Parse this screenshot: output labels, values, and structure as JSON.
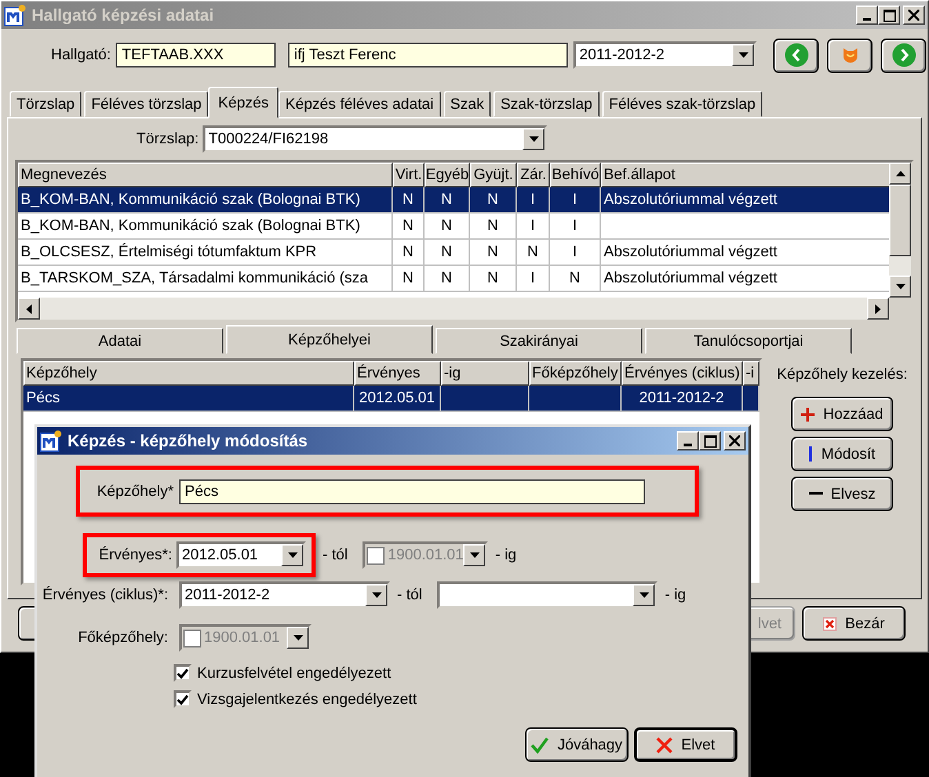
{
  "window": {
    "title": "Hallgató képzési adatai"
  },
  "student": {
    "label": "Hallgató:",
    "code": "TEFTAAB.XXX",
    "name": "ifj Teszt Ferenc",
    "term": "2011-2012-2"
  },
  "tabs": [
    {
      "label": "Törzslap",
      "selected": false
    },
    {
      "label": "Féléves törzslap",
      "selected": false
    },
    {
      "label": "Képzés",
      "selected": true
    },
    {
      "label": "Képzés féléves adatai",
      "selected": false
    },
    {
      "label": "Szak",
      "selected": false
    },
    {
      "label": "Szak-törzslap",
      "selected": false
    },
    {
      "label": "Féléves szak-törzslap",
      "selected": false
    }
  ],
  "record": {
    "label": "Törzslap:",
    "value": "T000224/FI62198"
  },
  "table": {
    "columns": [
      "Megnevezés",
      "Virt.",
      "Egyéb",
      "Gyüjt.",
      "Zár.",
      "Behívó",
      "Bef.állapot"
    ],
    "rows": [
      {
        "cells": [
          "B_KOM-BAN, Kommunikáció szak (Bolognai BTK)",
          "N",
          "N",
          "N",
          "I",
          "I",
          "Abszolutóriummal végzett"
        ],
        "selected": true
      },
      {
        "cells": [
          "B_KOM-BAN, Kommunikáció szak (Bolognai BTK)",
          "N",
          "N",
          "N",
          "I",
          "I",
          ""
        ],
        "selected": false
      },
      {
        "cells": [
          "B_OLCSESZ, Értelmiségi tótumfaktum KPR",
          "N",
          "N",
          "N",
          "N",
          "I",
          "Abszolutóriummal végzett"
        ],
        "selected": false
      },
      {
        "cells": [
          "B_TARSKOM_SZA, Társadalmi kommunikáció (sza",
          "N",
          "N",
          "N",
          "I",
          "N",
          "Abszolutóriummal végzett"
        ],
        "selected": false
      }
    ]
  },
  "subtabs": [
    {
      "label": "Adatai",
      "selected": false
    },
    {
      "label": "Képzőhelyei",
      "selected": true
    },
    {
      "label": "Szakirányai",
      "selected": false
    },
    {
      "label": "Tanulócsoportjai",
      "selected": false
    }
  ],
  "sites_table": {
    "columns": [
      "Képzőhely",
      "Érvényes",
      "-ig",
      "Főképzőhely",
      "Érvényes (ciklus)",
      "-i"
    ],
    "rows": [
      {
        "cells": [
          "Pécs",
          "2012.05.01",
          "",
          "",
          "2011-2012-2",
          ""
        ],
        "selected": true
      }
    ]
  },
  "site_actions": {
    "title": "Képzőhely kezelés:",
    "buttons": [
      {
        "label": "Hozzáad",
        "kind": "add"
      },
      {
        "label": "Módosít",
        "kind": "edit"
      },
      {
        "label": "Elvesz",
        "kind": "remove"
      }
    ]
  },
  "footer_buttons": [
    {
      "label": "lvet",
      "kind": "cancel",
      "disabled": true
    },
    {
      "label": "Bezár",
      "kind": "close",
      "disabled": false
    }
  ],
  "dialog": {
    "title": "Képzés - képzőhely módosítás",
    "site": {
      "label": "Képzőhely*",
      "value": "Pécs",
      "highlighted": true
    },
    "valid": {
      "label": "Érvényes*:",
      "value": "2012.05.01",
      "highlighted": true,
      "from": "- tól",
      "until_value": "1900.01.01",
      "until_checked": false,
      "until_disabled": true,
      "until": "- ig"
    },
    "cycle": {
      "label": "Érvényes (ciklus)*:",
      "value": "2011-2012-2",
      "from": "- tól",
      "until": "- ig"
    },
    "main_site": {
      "label": "Főképzőhely:",
      "value": "1900.01.01",
      "checked": false,
      "disabled": true
    },
    "options": [
      {
        "label": "Kurzusfelvétel engedélyezett",
        "checked": true
      },
      {
        "label": "Vizsgajelentkezés engedélyezett",
        "checked": true
      }
    ],
    "buttons": [
      {
        "label": "Jóváhagy",
        "kind": "ok"
      },
      {
        "label": "Elvet",
        "kind": "cancel"
      }
    ]
  }
}
